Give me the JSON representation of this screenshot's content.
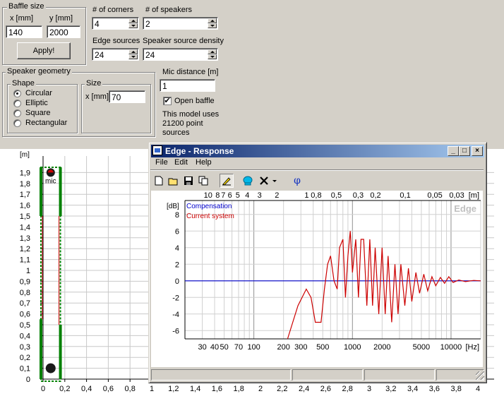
{
  "baffle": {
    "title": "Baffle size",
    "x_label": "x [mm]",
    "y_label": "y [mm]",
    "x_value": "140",
    "y_value": "2000",
    "apply_label": "Apply!"
  },
  "corners": {
    "label": "# of corners",
    "value": "4"
  },
  "speakers": {
    "label": "# of speakers",
    "value": "2"
  },
  "edge_sources": {
    "label": "Edge sources",
    "value": "24"
  },
  "speaker_density": {
    "label": "Speaker source density",
    "value": "24"
  },
  "mic": {
    "label": "Mic distance [m]",
    "value": "1",
    "open_baffle_label": "Open baffle",
    "open_baffle_checked": true
  },
  "model_info": {
    "line1": "This model uses",
    "line2": "21200 point",
    "line3": "sources"
  },
  "geometry": {
    "title": "Speaker geometry",
    "shape_title": "Shape",
    "shapes": [
      "Circular",
      "Elliptic",
      "Square",
      "Rectangular"
    ],
    "selected_shape": "Circular",
    "size_title": "Size",
    "size_label": "x [mm]",
    "size_value": "70"
  },
  "baffle_plot": {
    "unit_label": "[m]",
    "y_ticks": [
      "1,9",
      "1,8",
      "1,7",
      "1,6",
      "1,5",
      "1,4",
      "1,3",
      "1,2",
      "1,1",
      "1",
      "0,9",
      "0,8",
      "0,7",
      "0,6",
      "0,5",
      "0,4",
      "0,3",
      "0,2",
      "0,1",
      "0"
    ],
    "x_ticks": [
      "0",
      "0,2",
      "0,4",
      "0,6",
      "0,8",
      "1",
      "1,2",
      "1,4",
      "1,6",
      "1,8",
      "2",
      "2,2",
      "2,4",
      "2,6",
      "2,8",
      "3",
      "3,2",
      "3,4",
      "3,6",
      "3,8",
      "4"
    ],
    "mic_label": "mic",
    "colors": {
      "baffle": "#008000",
      "center_line": "#cc0000"
    }
  },
  "response_window": {
    "title": "Edge - Response",
    "menu": [
      "File",
      "Edit",
      "Help"
    ],
    "toolbar_icons": [
      "new-icon",
      "open-icon",
      "save-icon",
      "copy-icon",
      "pen-icon",
      "paint-icon",
      "delete-icon",
      "dropdown-icon",
      "phi-icon"
    ],
    "phi": "φ",
    "chart_data": {
      "type": "line",
      "title": "",
      "ylabel": "[dB]",
      "xlabel": "[Hz]",
      "top_axis_label": "[m]",
      "watermark": "Edge",
      "x_scale": "log",
      "xlim": [
        20,
        20000
      ],
      "ylim": [
        -7,
        9
      ],
      "y_ticks": [
        "8",
        "6",
        "4",
        "2",
        "0",
        "-2",
        "-4",
        "-6"
      ],
      "x_ticks": [
        "30",
        "40",
        "50",
        "70",
        "100",
        "200",
        "300",
        "500",
        "1000",
        "2000",
        "5000",
        "10000"
      ],
      "top_ticks": [
        "10",
        "8",
        "7",
        "6",
        "5",
        "4",
        "3",
        "2",
        "1",
        "0,8",
        "0,5",
        "0,3",
        "0,2",
        "0,1",
        "0,05",
        "0,03"
      ],
      "grid": true,
      "legend_position": "top-left",
      "series": [
        {
          "name": "Compensation",
          "color": "#0000cc",
          "x": [
            20,
            20000
          ],
          "y": [
            0,
            0
          ]
        },
        {
          "name": "Current system",
          "color": "#cc0000",
          "x": [
            220,
            280,
            340,
            380,
            420,
            480,
            520,
            560,
            600,
            650,
            700,
            740,
            800,
            850,
            900,
            950,
            1000,
            1080,
            1150,
            1220,
            1300,
            1400,
            1500,
            1600,
            1700,
            1850,
            2000,
            2150,
            2300,
            2500,
            2700,
            2900,
            3100,
            3400,
            3700,
            4000,
            4400,
            4800,
            5300,
            5800,
            6400,
            7000,
            7800,
            8600,
            9500,
            10500,
            12000,
            14000,
            17000,
            20000
          ],
          "y": [
            -7,
            -3,
            -1,
            -2,
            -5,
            -5,
            -1,
            2,
            3,
            0,
            -1,
            4,
            5,
            -2,
            3,
            6,
            1,
            5,
            -2,
            5,
            5,
            -3,
            5,
            -3,
            4,
            -4,
            4,
            -4,
            3,
            -5,
            2,
            -4,
            2,
            -3,
            1.5,
            -2.5,
            1,
            -1.5,
            0.8,
            -1.2,
            0.5,
            -0.6,
            0.4,
            -0.3,
            0.5,
            -0.2,
            0.1,
            -0.1,
            0.05,
            0
          ]
        }
      ]
    }
  }
}
